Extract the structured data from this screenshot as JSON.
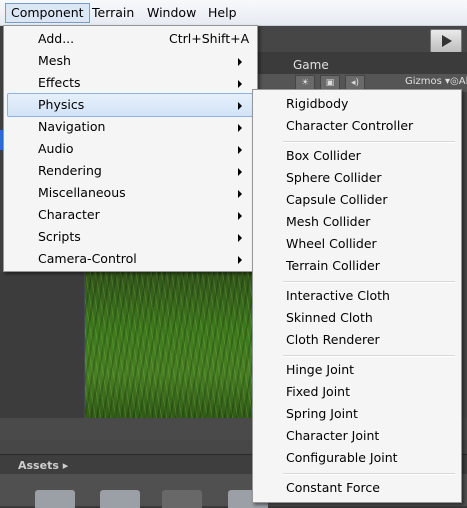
{
  "menubar": {
    "items": [
      "Component",
      "Terrain",
      "Window",
      "Help"
    ]
  },
  "toolbar": {
    "game_tab": "Game",
    "gizmos": "Gizmos ▾",
    "all": "◎All"
  },
  "component_menu": {
    "items": [
      {
        "label": "Add...",
        "shortcut": "Ctrl+Shift+A",
        "submenu": false
      },
      {
        "label": "Mesh",
        "submenu": true
      },
      {
        "label": "Effects",
        "submenu": true
      },
      {
        "label": "Physics",
        "submenu": true,
        "highlighted": true
      },
      {
        "label": "Navigation",
        "submenu": true
      },
      {
        "label": "Audio",
        "submenu": true
      },
      {
        "label": "Rendering",
        "submenu": true
      },
      {
        "label": "Miscellaneous",
        "submenu": true
      },
      {
        "label": "Character",
        "submenu": true
      },
      {
        "label": "Scripts",
        "submenu": true
      },
      {
        "label": "Camera-Control",
        "submenu": true
      }
    ]
  },
  "physics_menu": {
    "groups": [
      [
        "Rigidbody",
        "Character Controller"
      ],
      [
        "Box Collider",
        "Sphere Collider",
        "Capsule Collider",
        "Mesh Collider",
        "Wheel Collider",
        "Terrain Collider"
      ],
      [
        "Interactive Cloth",
        "Skinned Cloth",
        "Cloth Renderer"
      ],
      [
        "Hinge Joint",
        "Fixed Joint",
        "Spring Joint",
        "Character Joint",
        "Configurable Joint"
      ],
      [
        "Constant Force"
      ]
    ]
  },
  "assets": {
    "label": "Assets ▸"
  }
}
